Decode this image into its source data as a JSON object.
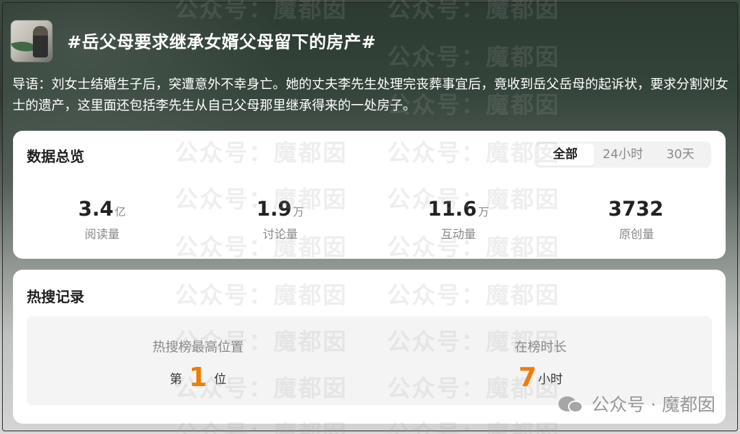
{
  "header": {
    "title": "#岳父母要求继承女婿父母留下的房产#"
  },
  "intro": "导语：刘女士结婚生子后，突遭意外不幸身亡。她的丈夫李先生处理完丧葬事宜后，竟收到岳父岳母的起诉状，要求分割刘女士的遗产，这里面还包括李先生从自己父母那里继承得来的一处房子。",
  "overview": {
    "title": "数据总览",
    "tabs": [
      "全部",
      "24小时",
      "30天"
    ],
    "stats": [
      {
        "value": "3.4",
        "unit": "亿",
        "label": "阅读量"
      },
      {
        "value": "1.9",
        "unit": "万",
        "label": "讨论量"
      },
      {
        "value": "11.6",
        "unit": "万",
        "label": "互动量"
      },
      {
        "value": "3732",
        "unit": "",
        "label": "原创量"
      }
    ]
  },
  "hot": {
    "title": "热搜记录",
    "rank_label": "热搜榜最高位置",
    "rank_prefix": "第",
    "rank_value": "1",
    "rank_suffix": "位",
    "duration_label": "在榜时长",
    "duration_value": "7",
    "duration_unit": "小时"
  },
  "watermark": {
    "text": "公众号：魔都囡",
    "brand": "公众号 · 魔都囡"
  }
}
